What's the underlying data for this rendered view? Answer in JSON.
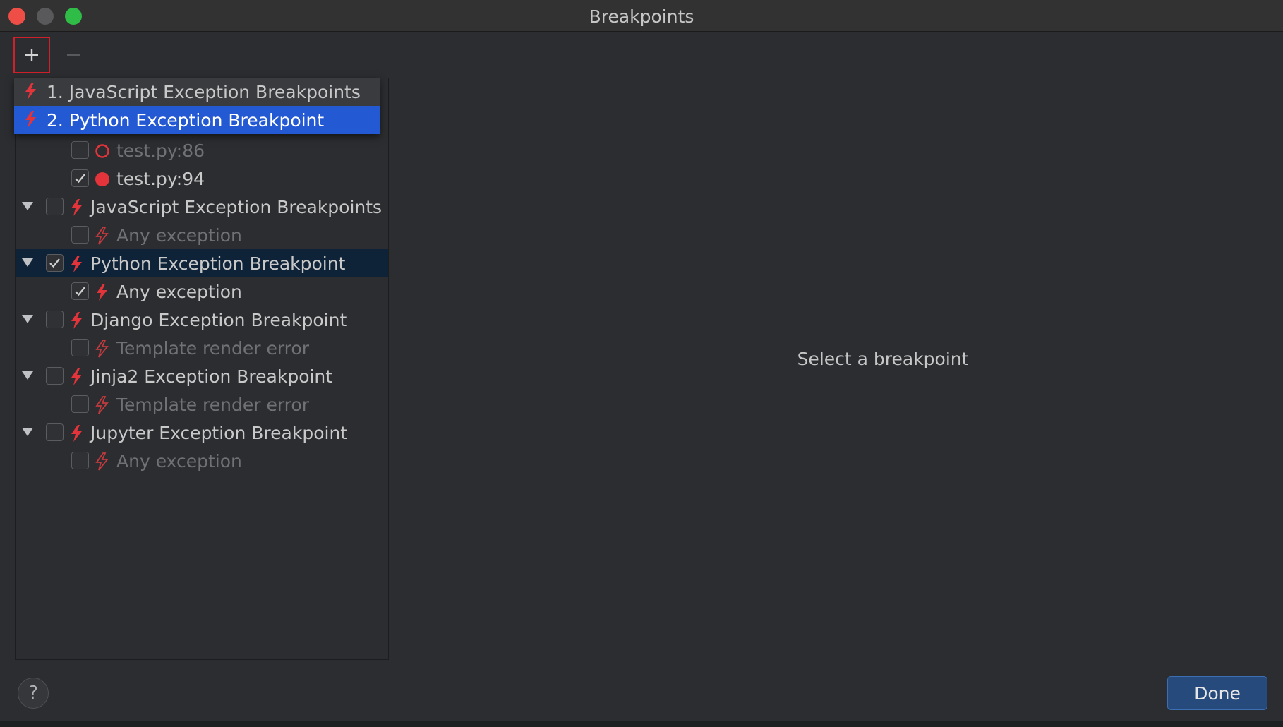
{
  "window": {
    "title": "Breakpoints",
    "traffic_lights": [
      "close",
      "minimize",
      "maximize"
    ]
  },
  "toolbar": {
    "add_icon": "plus-icon",
    "remove_icon": "minus-icon"
  },
  "popup_menu": {
    "items": [
      {
        "label": "1. JavaScript Exception Breakpoints",
        "icon": "lightning-icon",
        "highlighted": false
      },
      {
        "label": "2. Python Exception Breakpoint",
        "icon": "lightning-icon",
        "highlighted": true
      }
    ]
  },
  "tree": {
    "rows": [
      {
        "label": "test.py:86",
        "checked": false,
        "icon": "breakpoint-hollow-icon",
        "expander": false,
        "muted": true,
        "level": 1
      },
      {
        "label": "test.py:94",
        "checked": true,
        "icon": "breakpoint-filled-icon",
        "expander": false,
        "muted": false,
        "level": 1
      },
      {
        "label": "JavaScript Exception Breakpoints",
        "checked": false,
        "icon": "lightning-icon",
        "expander": true,
        "muted": false,
        "level": 0
      },
      {
        "label": "Any exception",
        "checked": false,
        "icon": "lightning-outline-icon",
        "expander": false,
        "muted": true,
        "level": 1
      },
      {
        "label": "Python Exception Breakpoint",
        "checked": true,
        "icon": "lightning-icon",
        "expander": true,
        "muted": false,
        "level": 0,
        "selected": true
      },
      {
        "label": "Any exception",
        "checked": true,
        "icon": "lightning-icon",
        "expander": false,
        "muted": false,
        "level": 1
      },
      {
        "label": "Django Exception Breakpoint",
        "checked": false,
        "icon": "lightning-icon",
        "expander": true,
        "muted": false,
        "level": 0
      },
      {
        "label": "Template render error",
        "checked": false,
        "icon": "lightning-outline-icon",
        "expander": false,
        "muted": true,
        "level": 1
      },
      {
        "label": "Jinja2 Exception Breakpoint",
        "checked": false,
        "icon": "lightning-icon",
        "expander": true,
        "muted": false,
        "level": 0
      },
      {
        "label": "Template render error",
        "checked": false,
        "icon": "lightning-outline-icon",
        "expander": false,
        "muted": true,
        "level": 1
      },
      {
        "label": "Jupyter Exception Breakpoint",
        "checked": false,
        "icon": "lightning-icon",
        "expander": true,
        "muted": false,
        "level": 0
      },
      {
        "label": "Any exception",
        "checked": false,
        "icon": "lightning-outline-icon",
        "expander": false,
        "muted": true,
        "level": 1
      }
    ]
  },
  "detail": {
    "placeholder": "Select a breakpoint"
  },
  "footer": {
    "help_label": "?",
    "done_label": "Done"
  },
  "colors": {
    "accent": "#2459d4",
    "selection": "#0e2238",
    "breakpoint_red": "#e3343b",
    "background": "#2b2d30"
  }
}
